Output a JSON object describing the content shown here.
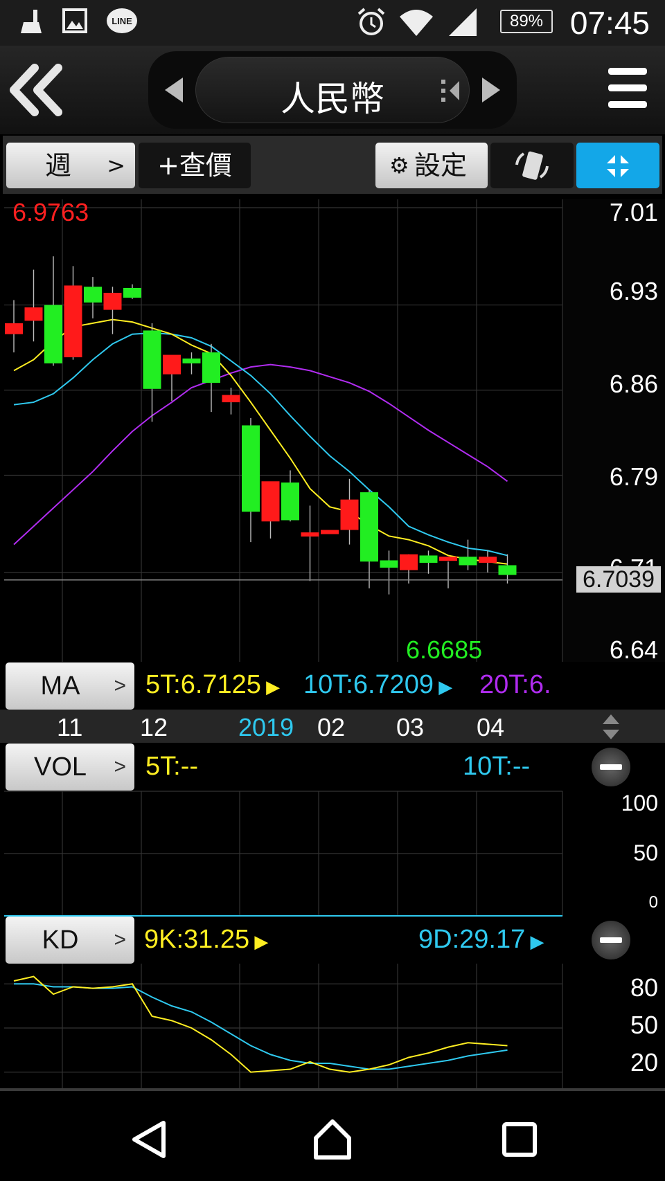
{
  "status_bar": {
    "time": "07:45",
    "battery": "89%",
    "icons": [
      "cleaner-icon",
      "gallery-icon",
      "line-app-icon",
      "alarm-icon",
      "wifi-icon",
      "signal-icon",
      "battery-icon"
    ]
  },
  "header": {
    "title": "人民幣"
  },
  "toolbar": {
    "period": "週",
    "period_chevron": ">",
    "query_label": "+查價",
    "settings_label": "設定"
  },
  "price_chart": {
    "high_label": "6.9763",
    "low_label": "6.6685",
    "last_price": "6.7039",
    "y_ticks": [
      "7.01",
      "6.93",
      "6.86",
      "6.79",
      "6.71",
      "6.64"
    ],
    "x_labels": [
      {
        "text": "11",
        "color": "#ffffff"
      },
      {
        "text": "12",
        "color": "#ffffff"
      },
      {
        "text": "2019",
        "color": "#2fc9ef"
      },
      {
        "text": "02",
        "color": "#ffffff"
      },
      {
        "text": "03",
        "color": "#ffffff"
      },
      {
        "text": "04",
        "color": "#ffffff"
      }
    ]
  },
  "ma": {
    "label": "MA",
    "ma5": "5T:6.7125",
    "ma10": "10T:6.7209",
    "ma20": "20T:6."
  },
  "vol": {
    "label": "VOL",
    "ma5": "5T:--",
    "ma10": "10T:--",
    "y_ticks": [
      "100",
      "50",
      "0"
    ]
  },
  "kd": {
    "label": "KD",
    "k": "9K:31.25",
    "d": "9D:29.17",
    "y_ticks": [
      "80",
      "50",
      "20"
    ]
  },
  "colors": {
    "up": "#ff1a1a",
    "down": "#22ee22",
    "ma5": "#ffee22",
    "ma10": "#2fc9ef",
    "ma20": "#b02cf0",
    "accent": "#13a7e8"
  },
  "chart_data": {
    "type": "candlestick",
    "title": "人民幣",
    "period": "週",
    "ylim": [
      6.64,
      7.01
    ],
    "candles": [
      {
        "o": 6.906,
        "h": 6.934,
        "l": 6.891,
        "c": 6.915
      },
      {
        "o": 6.917,
        "h": 6.959,
        "l": 6.9,
        "c": 6.928
      },
      {
        "o": 6.93,
        "h": 6.97,
        "l": 6.88,
        "c": 6.882
      },
      {
        "o": 6.887,
        "h": 6.962,
        "l": 6.885,
        "c": 6.946
      },
      {
        "o": 6.945,
        "h": 6.953,
        "l": 6.919,
        "c": 6.932
      },
      {
        "o": 6.926,
        "h": 6.945,
        "l": 6.906,
        "c": 6.94
      },
      {
        "o": 6.944,
        "h": 6.947,
        "l": 6.935,
        "c": 6.936
      },
      {
        "o": 6.909,
        "h": 6.915,
        "l": 6.834,
        "c": 6.861
      },
      {
        "o": 6.873,
        "h": 6.886,
        "l": 6.851,
        "c": 6.889
      },
      {
        "o": 6.886,
        "h": 6.891,
        "l": 6.873,
        "c": 6.882
      },
      {
        "o": 6.891,
        "h": 6.898,
        "l": 6.842,
        "c": 6.866
      },
      {
        "o": 6.85,
        "h": 6.862,
        "l": 6.84,
        "c": 6.856
      },
      {
        "o": 6.831,
        "h": 6.837,
        "l": 6.735,
        "c": 6.76
      },
      {
        "o": 6.752,
        "h": 6.767,
        "l": 6.738,
        "c": 6.785
      },
      {
        "o": 6.784,
        "h": 6.794,
        "l": 6.752,
        "c": 6.753
      },
      {
        "o": 6.741,
        "h": 6.765,
        "l": 6.703,
        "c": 6.743
      },
      {
        "o": 6.743,
        "h": 6.744,
        "l": 6.743,
        "c": 6.745
      },
      {
        "o": 6.745,
        "h": 6.787,
        "l": 6.733,
        "c": 6.77
      },
      {
        "o": 6.776,
        "h": 6.778,
        "l": 6.697,
        "c": 6.719
      },
      {
        "o": 6.72,
        "h": 6.728,
        "l": 6.692,
        "c": 6.714
      },
      {
        "o": 6.712,
        "h": 6.725,
        "l": 6.701,
        "c": 6.725
      },
      {
        "o": 6.724,
        "h": 6.728,
        "l": 6.709,
        "c": 6.718
      },
      {
        "o": 6.72,
        "h": 6.719,
        "l": 6.697,
        "c": 6.723
      },
      {
        "o": 6.723,
        "h": 6.737,
        "l": 6.712,
        "c": 6.716
      },
      {
        "o": 6.718,
        "h": 6.728,
        "l": 6.71,
        "c": 6.723
      },
      {
        "o": 6.716,
        "h": 6.725,
        "l": 6.701,
        "c": 6.708
      }
    ],
    "ma5": [
      6.876,
      6.885,
      6.9,
      6.912,
      6.915,
      6.918,
      6.916,
      6.911,
      6.906,
      6.897,
      6.89,
      6.872,
      6.85,
      6.827,
      6.804,
      6.779,
      6.764,
      6.76,
      6.749,
      6.74,
      6.737,
      6.732,
      6.724,
      6.721,
      6.719,
      6.717
    ],
    "ma10": [
      6.848,
      6.85,
      6.857,
      6.87,
      6.885,
      6.898,
      6.906,
      6.907,
      6.906,
      6.903,
      6.896,
      6.884,
      6.872,
      6.857,
      6.839,
      6.822,
      6.806,
      6.793,
      6.778,
      6.764,
      6.748,
      6.741,
      6.735,
      6.73,
      6.728,
      6.724
    ],
    "ma20": [
      6.733,
      6.748,
      6.763,
      6.778,
      6.793,
      6.81,
      6.826,
      6.839,
      6.85,
      6.862,
      6.868,
      6.874,
      6.879,
      6.881,
      6.879,
      6.876,
      6.871,
      6.866,
      6.859,
      6.849,
      6.838,
      6.827,
      6.817,
      6.807,
      6.797,
      6.785
    ],
    "k": [
      82,
      85,
      73,
      78,
      77,
      78,
      80,
      58,
      55,
      50,
      42,
      32,
      20,
      21,
      22,
      27,
      22,
      20,
      22,
      25,
      30,
      33,
      37,
      40,
      39,
      38
    ],
    "d": [
      80,
      80,
      78,
      78,
      77,
      77,
      78,
      71,
      65,
      61,
      54,
      46,
      38,
      32,
      28,
      26,
      26,
      24,
      22,
      22,
      24,
      26,
      28,
      31,
      33,
      35
    ]
  }
}
